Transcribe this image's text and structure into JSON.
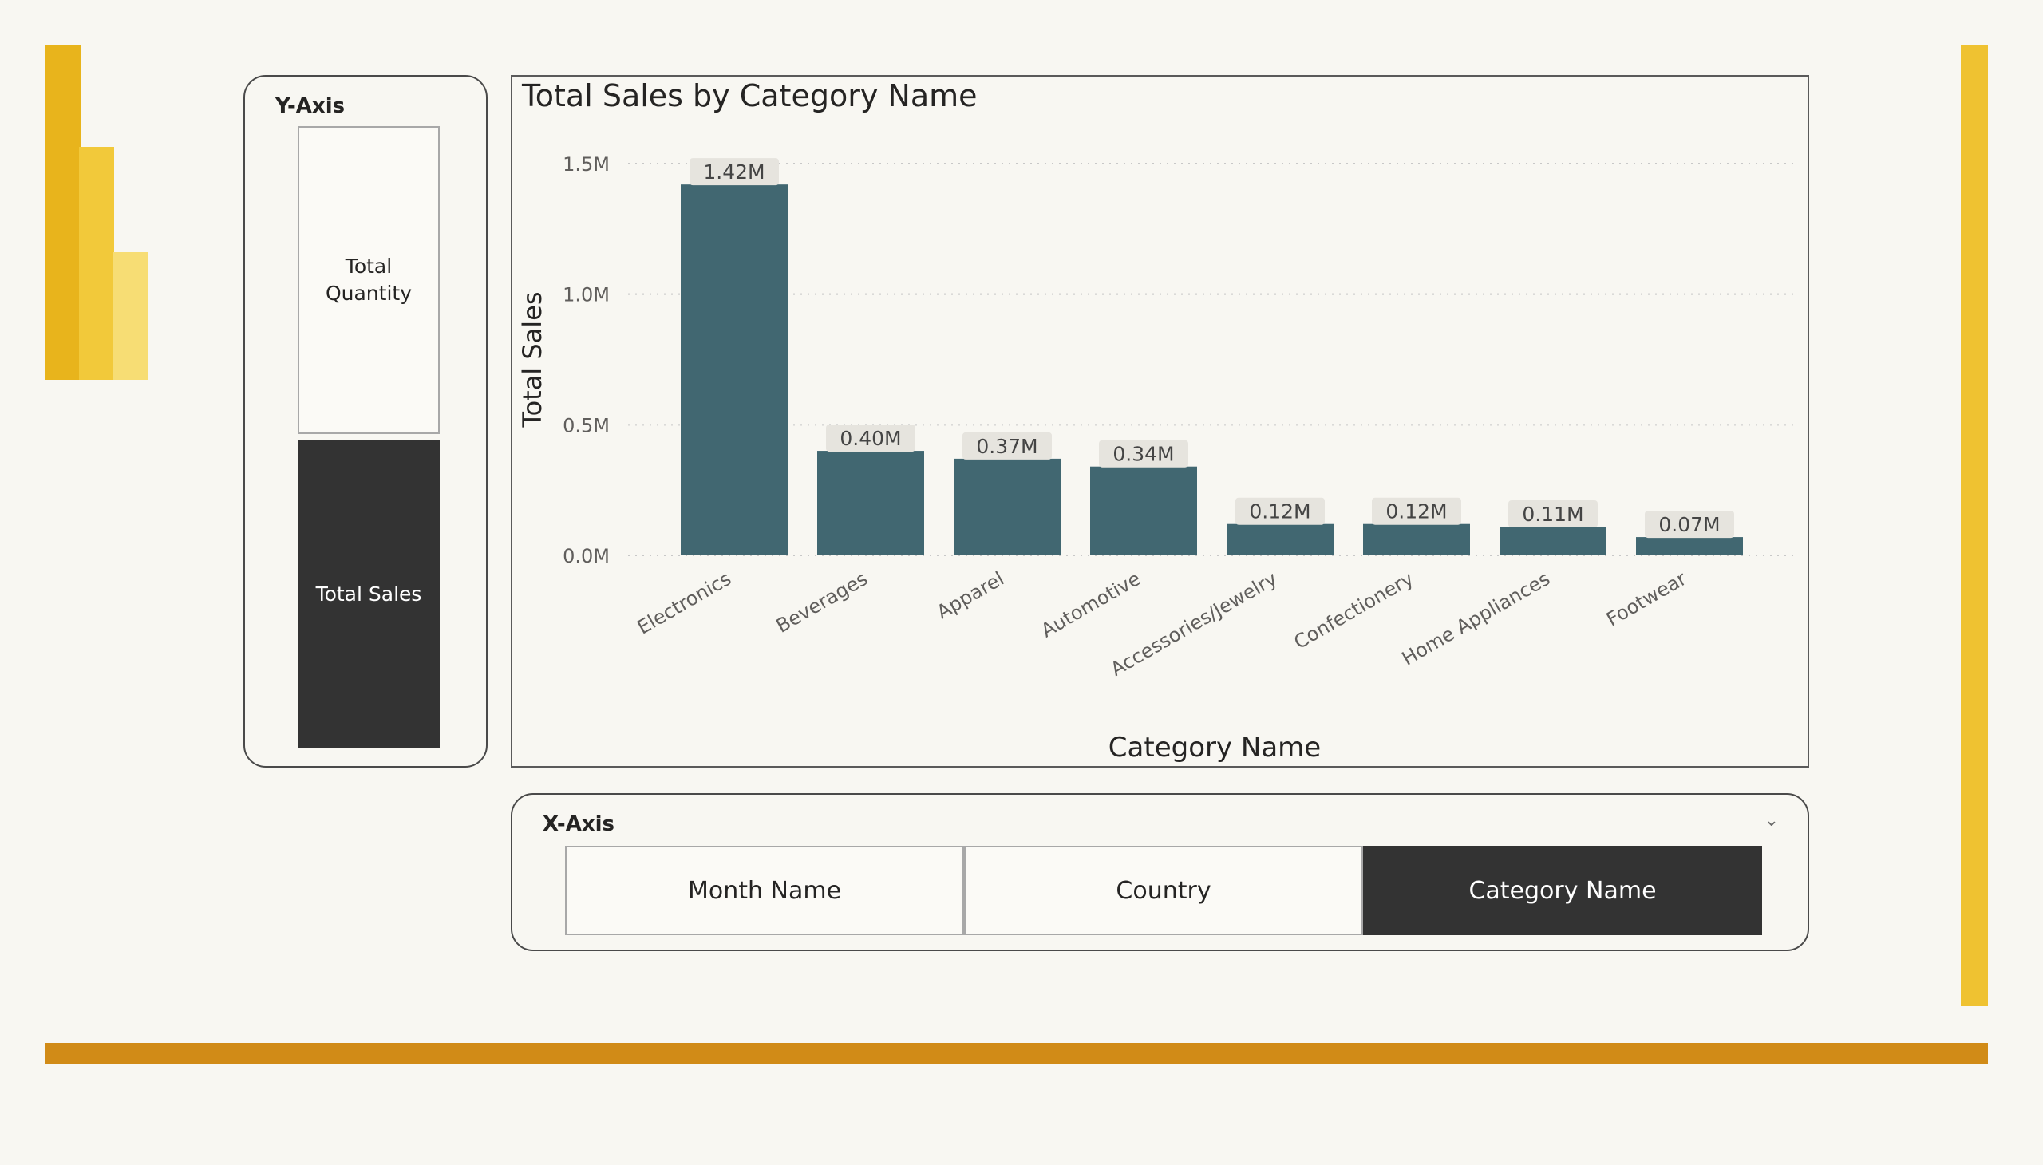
{
  "y_slicer": {
    "title": "Y-Axis",
    "options": [
      {
        "label": "Total Quantity",
        "selected": false
      },
      {
        "label": "Total Sales",
        "selected": true
      }
    ]
  },
  "x_slicer": {
    "title": "X-Axis",
    "options": [
      {
        "label": "Month Name",
        "selected": false
      },
      {
        "label": "Country",
        "selected": false
      },
      {
        "label": "Category Name",
        "selected": true
      }
    ]
  },
  "colors": {
    "bar": "#416771",
    "accent_yellow": "#efc231",
    "accent_orange": "#d18b17",
    "selected_bg": "#333333"
  },
  "chart_data": {
    "type": "bar",
    "title": "Total Sales by Category Name",
    "xlabel": "Category Name",
    "ylabel": "Total Sales",
    "categories": [
      "Electronics",
      "Beverages",
      "Apparel",
      "Automotive",
      "Accessories/Jewelry",
      "Confectionery",
      "Home Appliances",
      "Footwear"
    ],
    "values": [
      1.42,
      0.4,
      0.37,
      0.34,
      0.12,
      0.12,
      0.11,
      0.07
    ],
    "data_labels": [
      "1.42M",
      "0.40M",
      "0.37M",
      "0.34M",
      "0.12M",
      "0.12M",
      "0.11M",
      "0.07M"
    ],
    "yticks": [
      0,
      0.5,
      1.0,
      1.5
    ],
    "ytick_labels": [
      "0.0M",
      "0.5M",
      "1.0M",
      "1.5M"
    ],
    "ylim": [
      0,
      1.5
    ],
    "grid": true,
    "legend": "none"
  }
}
